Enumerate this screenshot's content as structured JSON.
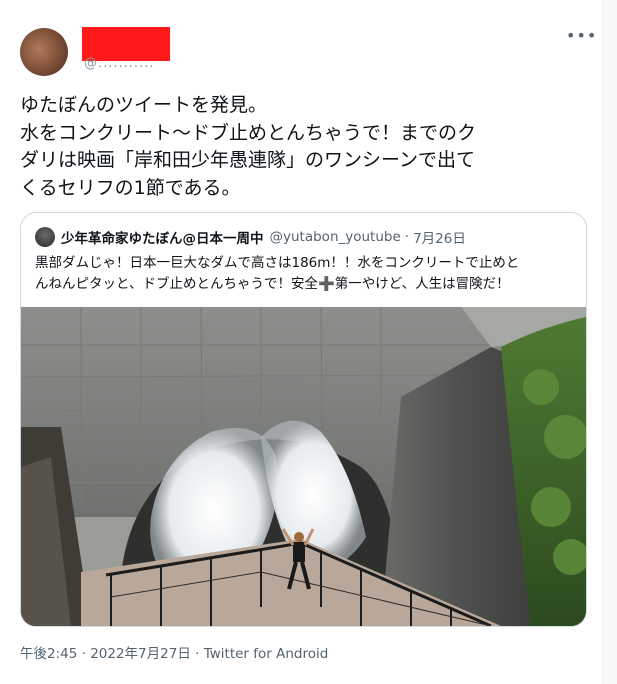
{
  "tweet": {
    "author_handle_partial": "@...........",
    "more_icon": "more-horizontal-icon",
    "text_lines": [
      "ゆたぼんのツイートを発見。",
      "水をコンクリート～ドブ止めとんちゃうで！までのク",
      "ダリは映画「岸和田少年愚連隊」のワンシーンで出て",
      "くるセリフの1節である。"
    ],
    "timestamp": "午後2:45 · 2022年7月27日",
    "separator": "·",
    "source": "Twitter for Android"
  },
  "quoted_tweet": {
    "name": "少年革命家ゆたぼん@日本一周中",
    "handle": "@yutabon_youtube",
    "separator": "·",
    "date": "7月26日",
    "text_lines": [
      "黒部ダムじゃ！日本一巨大なダムで高さは186m！！水をコンクリートで止めと",
      "んねんピタッと、ドブ止めとんちゃうで！安全➕第一やけど、人生は冒険だ！"
    ]
  },
  "colors": {
    "text": "#0f1419",
    "secondary": "#536471",
    "border": "#cfd9de",
    "redaction": "#ff1a1a"
  }
}
